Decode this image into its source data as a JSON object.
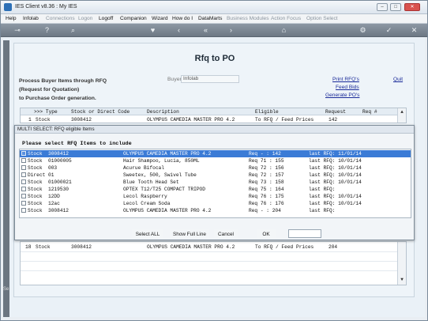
{
  "window": {
    "title": "IES Client v8.36 : My IES",
    "minimize": "–",
    "maximize": "□",
    "close": "✕"
  },
  "menu": [
    {
      "label": "Help",
      "enabled": true
    },
    {
      "label": "Infolab",
      "enabled": true
    },
    {
      "label": "Connections",
      "enabled": false
    },
    {
      "label": "Logon",
      "enabled": false
    },
    {
      "label": "Logoff",
      "enabled": true
    },
    {
      "label": "Companion",
      "enabled": true
    },
    {
      "label": "Wizard",
      "enabled": true
    },
    {
      "label": "How do I",
      "enabled": true
    },
    {
      "label": "DataMarts",
      "enabled": true
    },
    {
      "label": "Business Modules",
      "enabled": false
    },
    {
      "label": "Action Focus",
      "enabled": false
    },
    {
      "label": "Option Select",
      "enabled": false
    }
  ],
  "toolbar": {
    "icons": [
      "key-icon",
      "help-icon",
      "search-icon",
      "heart-icon",
      "back-icon",
      "rewind-icon",
      "forward-icon",
      "home-icon",
      "settings-icon",
      "check-icon",
      "close-icon"
    ]
  },
  "panel": {
    "title": "Rfq to PO",
    "description_lines": [
      "Process Buyer Items through RFQ",
      "(Request for Quotation)",
      "to Purchase Order generation."
    ],
    "buyer_label": "Buyer",
    "buyer_value": "Infolab",
    "links": {
      "print_rfqs": "Print RFQ's",
      "quit": "Quit",
      "feed_bids": "Feed Bids",
      "generate_pos": "Generate PO's"
    }
  },
  "grid": {
    "headers": [
      ">>> Type",
      "Stock or Direct Code",
      "Description",
      "Eligible",
      "Request",
      "Req #"
    ],
    "rows": [
      {
        "num": "1",
        "type": "Stock",
        "code": "3008412",
        "description": "OLYMPUS CAMEDIA MASTER PRO 4.2",
        "eligible": "To RFQ / Feed Prices",
        "request": "142"
      },
      {
        "num": "18",
        "type": "Stock",
        "code": "3008412",
        "description": "OLYMPUS CAMEDIA MASTER PRO 4.2",
        "eligible": "To RFQ / Feed Prices",
        "request": "204"
      }
    ]
  },
  "dialog": {
    "title": "MULTI SELECT: RFQ eligible Items",
    "prompt": "Please select RFQ Items to include",
    "items": [
      {
        "type": "Stock",
        "code": "3008412",
        "description": "OLYMPUS CAMEDIA MASTER PRO 4.2",
        "req": "Req - : 142",
        "last_rfq": "last RFQ: 11/01/14",
        "selected": true
      },
      {
        "type": "Stock",
        "code": "01000005",
        "description": "Hair Shampoo, Lucia, 850ML",
        "req": "Req 71 : 155",
        "last_rfq": "last RFQ: 10/01/14",
        "selected": false
      },
      {
        "type": "Stock",
        "code": "003",
        "description": "Acurue Bifocal",
        "req": "Req 72 : 156",
        "last_rfq": "last RFQ: 10/01/14",
        "selected": false
      },
      {
        "type": "Direct",
        "code": "01",
        "description": "Sweetex, 500, Swivel Tube",
        "req": "Req 72 : 157",
        "last_rfq": "last RFQ: 10/01/14",
        "selected": false
      },
      {
        "type": "Stock",
        "code": "01000021",
        "description": "Blue Tooth Head Set",
        "req": "Req 73 : 158",
        "last_rfq": "last RFQ: 10/01/14",
        "selected": false
      },
      {
        "type": "Stock",
        "code": "1219530",
        "description": "OPTEX T12/T25 COMPACT TRIPOD",
        "req": "Req 75 : 164",
        "last_rfq": "last RFQ:",
        "selected": false
      },
      {
        "type": "Stock",
        "code": "12DD",
        "description": "Lecol Raspberry",
        "req": "Req 76 : 175",
        "last_rfq": "last RFQ: 10/01/14",
        "selected": false
      },
      {
        "type": "Stock",
        "code": "12ac",
        "description": "Lecol Cream Soda",
        "req": "Req 76 : 176",
        "last_rfq": "last RFQ: 10/01/14",
        "selected": false
      },
      {
        "type": "Stock",
        "code": "3008412",
        "description": "OLYMPUS CAMEDIA MASTER PRO 4.2",
        "req": "Req - : 204",
        "last_rfq": "last RFQ:",
        "selected": false
      }
    ],
    "buttons": {
      "select_all": "Select ALL",
      "show_full_line": "Show Full Line",
      "cancel": "Cancel",
      "ok": "OK"
    }
  },
  "side_label": "Se"
}
